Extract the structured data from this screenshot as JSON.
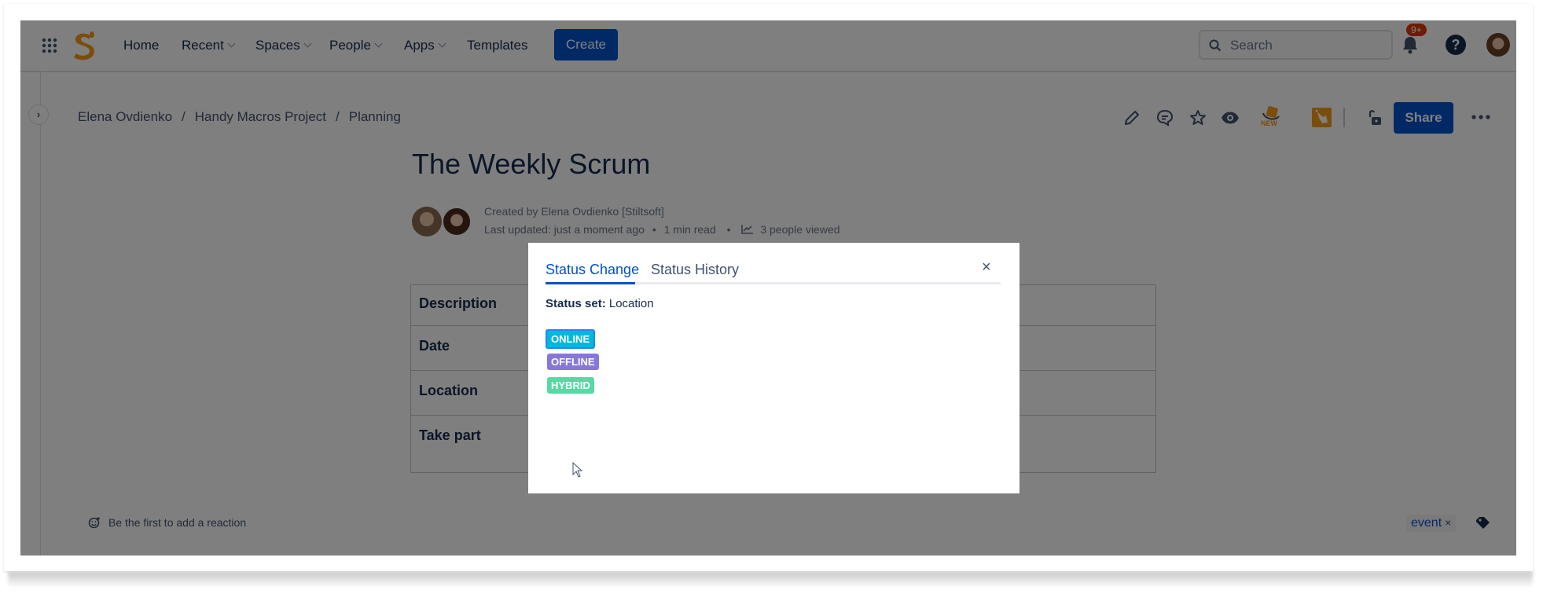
{
  "header": {
    "nav": [
      {
        "label": "Home",
        "dropdown": false
      },
      {
        "label": "Recent",
        "dropdown": true
      },
      {
        "label": "Spaces",
        "dropdown": true
      },
      {
        "label": "People",
        "dropdown": true
      },
      {
        "label": "Apps",
        "dropdown": true
      },
      {
        "label": "Templates",
        "dropdown": false
      }
    ],
    "create_label": "Create",
    "search_placeholder": "Search",
    "notifications_badge": "9+",
    "help_glyph": "?"
  },
  "breadcrumb": {
    "items": [
      "Elena Ovdienko",
      "Handy Macros Project",
      "Planning"
    ],
    "separator": "/"
  },
  "toolbar": {
    "share_label": "Share",
    "new_badge": "NEW"
  },
  "page": {
    "title": "The Weekly Scrum",
    "created_by": "Created by Elena Ovdienko [Stiltsoft]",
    "last_updated": "Last updated: just a moment ago",
    "read_time": "1 min read",
    "views": "3 people viewed",
    "bullet": "•"
  },
  "table": {
    "rows": [
      "Description",
      "Date",
      "Location",
      "Take part"
    ]
  },
  "footer": {
    "reaction_text": "Be the first to add a reaction",
    "labels": [
      "event"
    ],
    "label_remove": "×"
  },
  "modal": {
    "tabs": [
      "Status Change",
      "Status History"
    ],
    "active_tab": 0,
    "close_glyph": "×",
    "status_set_label": "Status set:",
    "status_set_value": "Location",
    "statuses": [
      {
        "label": "ONLINE",
        "color": "#00b8d9",
        "selected": true
      },
      {
        "label": "OFFLINE",
        "color": "#8777d9",
        "selected": false
      },
      {
        "label": "HYBRID",
        "color": "#57d9a3",
        "selected": false
      }
    ]
  },
  "colors": {
    "primary": "#0052cc",
    "text": "#172b4d",
    "logo": "#f79a1b",
    "badge": "#de350b"
  }
}
